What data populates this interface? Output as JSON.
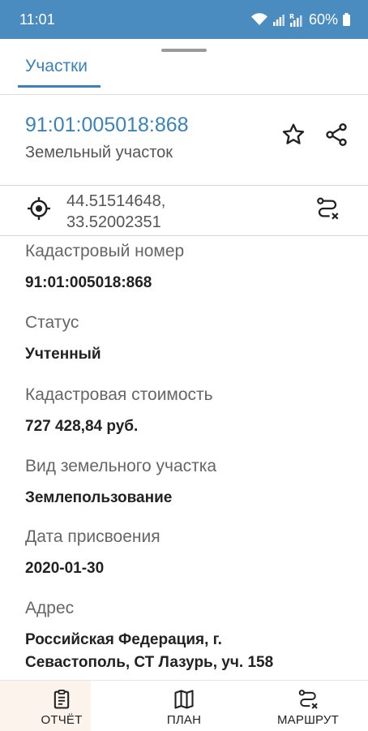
{
  "status_bar": {
    "time": "11:01",
    "battery": "60%",
    "icons": [
      "wifi-icon",
      "signal-icon",
      "signal-r-icon",
      "battery-icon"
    ]
  },
  "tab": {
    "label": "Участки"
  },
  "header": {
    "cadastral_number": "91:01:005018:868",
    "object_type": "Земельный участок",
    "actions": [
      "star-icon",
      "share-icon"
    ]
  },
  "coordinates": {
    "lat": "44.51514648,",
    "lon": "33.52002351",
    "icons": [
      "location-target-icon",
      "route-icon"
    ]
  },
  "fields": [
    {
      "label": "Кадастровый номер",
      "value": "91:01:005018:868"
    },
    {
      "label": "Статус",
      "value": "Учтенный"
    },
    {
      "label": "Кадастровая стоимость",
      "value": "727 428,84 руб."
    },
    {
      "label": "Вид земельного участка",
      "value": "Землепользование"
    },
    {
      "label": "Дата присвоения",
      "value": "2020-01-30"
    },
    {
      "label": "Адрес",
      "value": "Российская Федерация, г. Севастополь, СТ Лазурь, уч. 158"
    }
  ],
  "bottom_nav": [
    {
      "label": "ОТЧЁТ",
      "icon": "report-clipboard-icon"
    },
    {
      "label": "ПЛАН",
      "icon": "map-icon"
    },
    {
      "label": "МАРШРУТ",
      "icon": "route-icon"
    }
  ],
  "colors": {
    "status_bar": "#4a8bc0",
    "accent": "#3a82b8",
    "text_primary": "#222222",
    "text_secondary": "#666666"
  }
}
